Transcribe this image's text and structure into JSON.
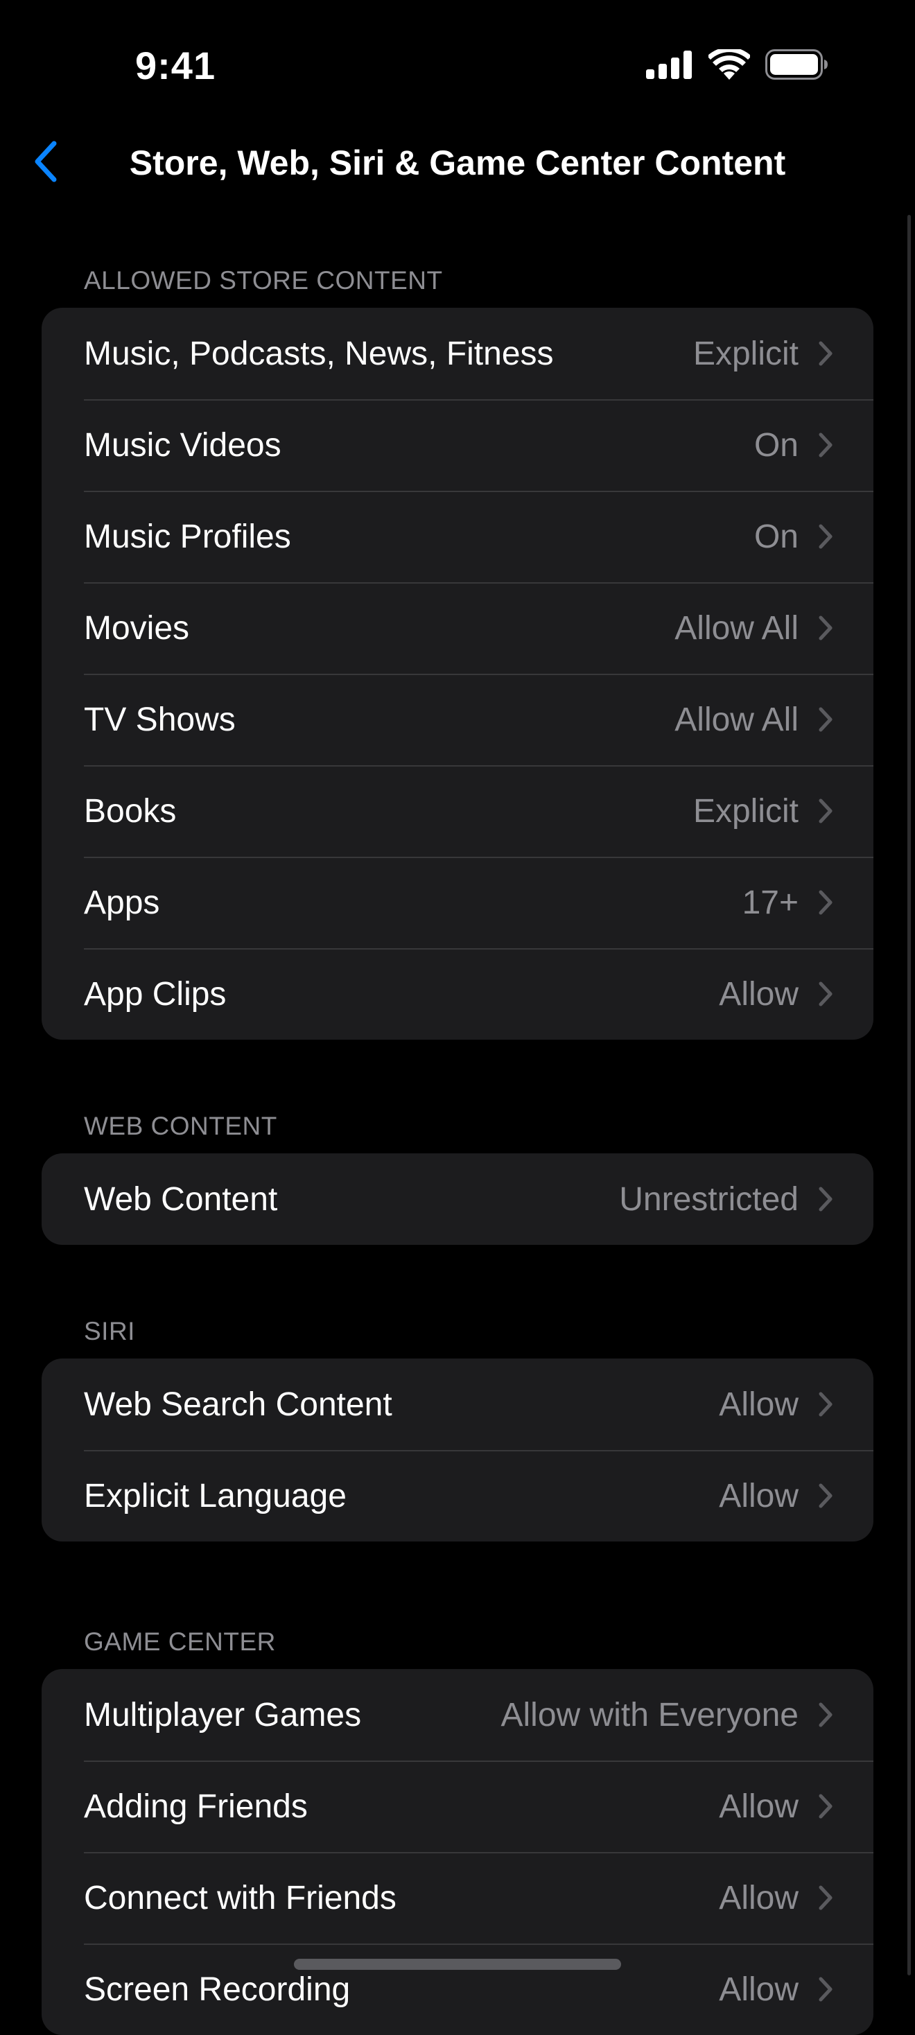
{
  "status_bar": {
    "time": "9:41"
  },
  "nav": {
    "title": "Store, Web, Siri & Game Center Content",
    "back_icon": "chevron-left-icon",
    "accent_color": "#0a84ff"
  },
  "sections": {
    "store": {
      "header": "ALLOWED STORE CONTENT",
      "rows": [
        {
          "label": "Music, Podcasts, News, Fitness",
          "value": "Explicit"
        },
        {
          "label": "Music Videos",
          "value": "On"
        },
        {
          "label": "Music Profiles",
          "value": "On"
        },
        {
          "label": "Movies",
          "value": "Allow All"
        },
        {
          "label": "TV Shows",
          "value": "Allow All"
        },
        {
          "label": "Books",
          "value": "Explicit"
        },
        {
          "label": "Apps",
          "value": "17+"
        },
        {
          "label": "App Clips",
          "value": "Allow"
        }
      ]
    },
    "web": {
      "header": "WEB CONTENT",
      "rows": [
        {
          "label": "Web Content",
          "value": "Unrestricted"
        }
      ]
    },
    "siri": {
      "header": "SIRI",
      "rows": [
        {
          "label": "Web Search Content",
          "value": "Allow"
        },
        {
          "label": "Explicit Language",
          "value": "Allow"
        }
      ]
    },
    "game_center": {
      "header": "GAME CENTER",
      "rows": [
        {
          "label": "Multiplayer Games",
          "value": "Allow with Everyone"
        },
        {
          "label": "Adding Friends",
          "value": "Allow"
        },
        {
          "label": "Connect with Friends",
          "value": "Allow"
        },
        {
          "label": "Screen Recording",
          "value": "Allow"
        }
      ]
    }
  }
}
